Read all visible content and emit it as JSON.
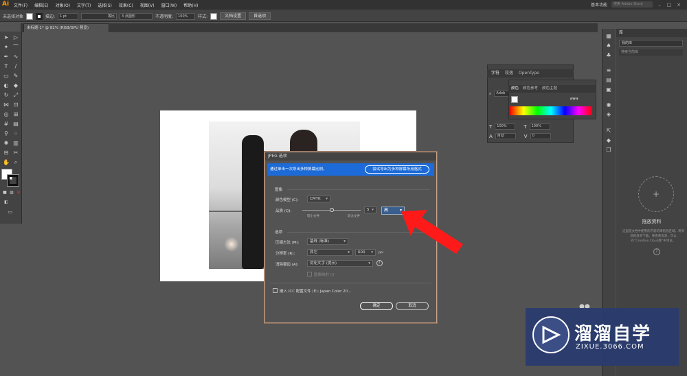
{
  "menubar": {
    "logo": "Ai",
    "items": [
      "文件(F)",
      "编辑(E)",
      "对象(O)",
      "文字(T)",
      "选择(S)",
      "效果(C)",
      "视图(V)",
      "窗口(W)",
      "帮助(H)"
    ],
    "workspace": "基本功能",
    "search_placeholder": "搜索 Adobe Stock"
  },
  "controlbar": {
    "selection": "未选择对象",
    "stroke_label": "描边:",
    "stroke_weight": "1 pt",
    "stroke_style": "等比",
    "brush": "3 点圆形",
    "opacity_label": "不透明度:",
    "opacity": "100%",
    "style_label": "样式:",
    "doc_setup": "文档设置",
    "prefs": "首选项"
  },
  "doc_tab": "未标题-1* @ 82% (RGB/GPU 预览)",
  "char_panel": {
    "tabs": [
      "字符",
      "段落",
      "OpenType"
    ],
    "font": "Adob",
    "scale_h": "100%",
    "scale_v": "100%",
    "auto": "自动",
    "tracking": "0"
  },
  "color_panel": {
    "tabs": [
      "颜色",
      "颜色参考",
      "颜色主题"
    ],
    "hex": "ffffff"
  },
  "right_panel": {
    "header": "库",
    "select": "我的库",
    "search": "搜索当前库",
    "drop_title": "拖放资料",
    "drop_desc": "这里是文档中使用的内容的库拖放区域，将资源拖放到下面。要查看资源，可以在“Creative Cloud库”中浏览。",
    "help_icon": "?"
  },
  "dialog": {
    "title": "JPEG 选项",
    "banner_text": "通过单击一次导出多种屏幕比例。",
    "banner_button": "尝试导出为多种屏幕所用格式",
    "section_image": "图像",
    "color_model_label": "颜色模型 (C):",
    "color_model": "CMYK",
    "quality_label": "品质 (Q):",
    "quality_value": "5",
    "quality_fraction": 0.5,
    "quality_small": "较小文件",
    "quality_large": "较大文件",
    "quality_select": "高",
    "section_options": "选项",
    "compression_label": "压缩方法 (M):",
    "compression": "基线 (标准)",
    "resolution_label": "分辨率 (R):",
    "resolution": "其它",
    "resolution_value": "600",
    "resolution_unit": "ppi",
    "antialias_label": "消除锯齿 (A):",
    "antialias": "优化文字 (提示)",
    "imagemap_label": "图像映射 (I)",
    "embed_label": "嵌入 ICC 配置文件 (E): Japan Color 20...",
    "ok": "确定",
    "cancel": "取消"
  },
  "watermark": {
    "title": "溜溜自学",
    "url": "ZIXUE.3066.COM"
  }
}
